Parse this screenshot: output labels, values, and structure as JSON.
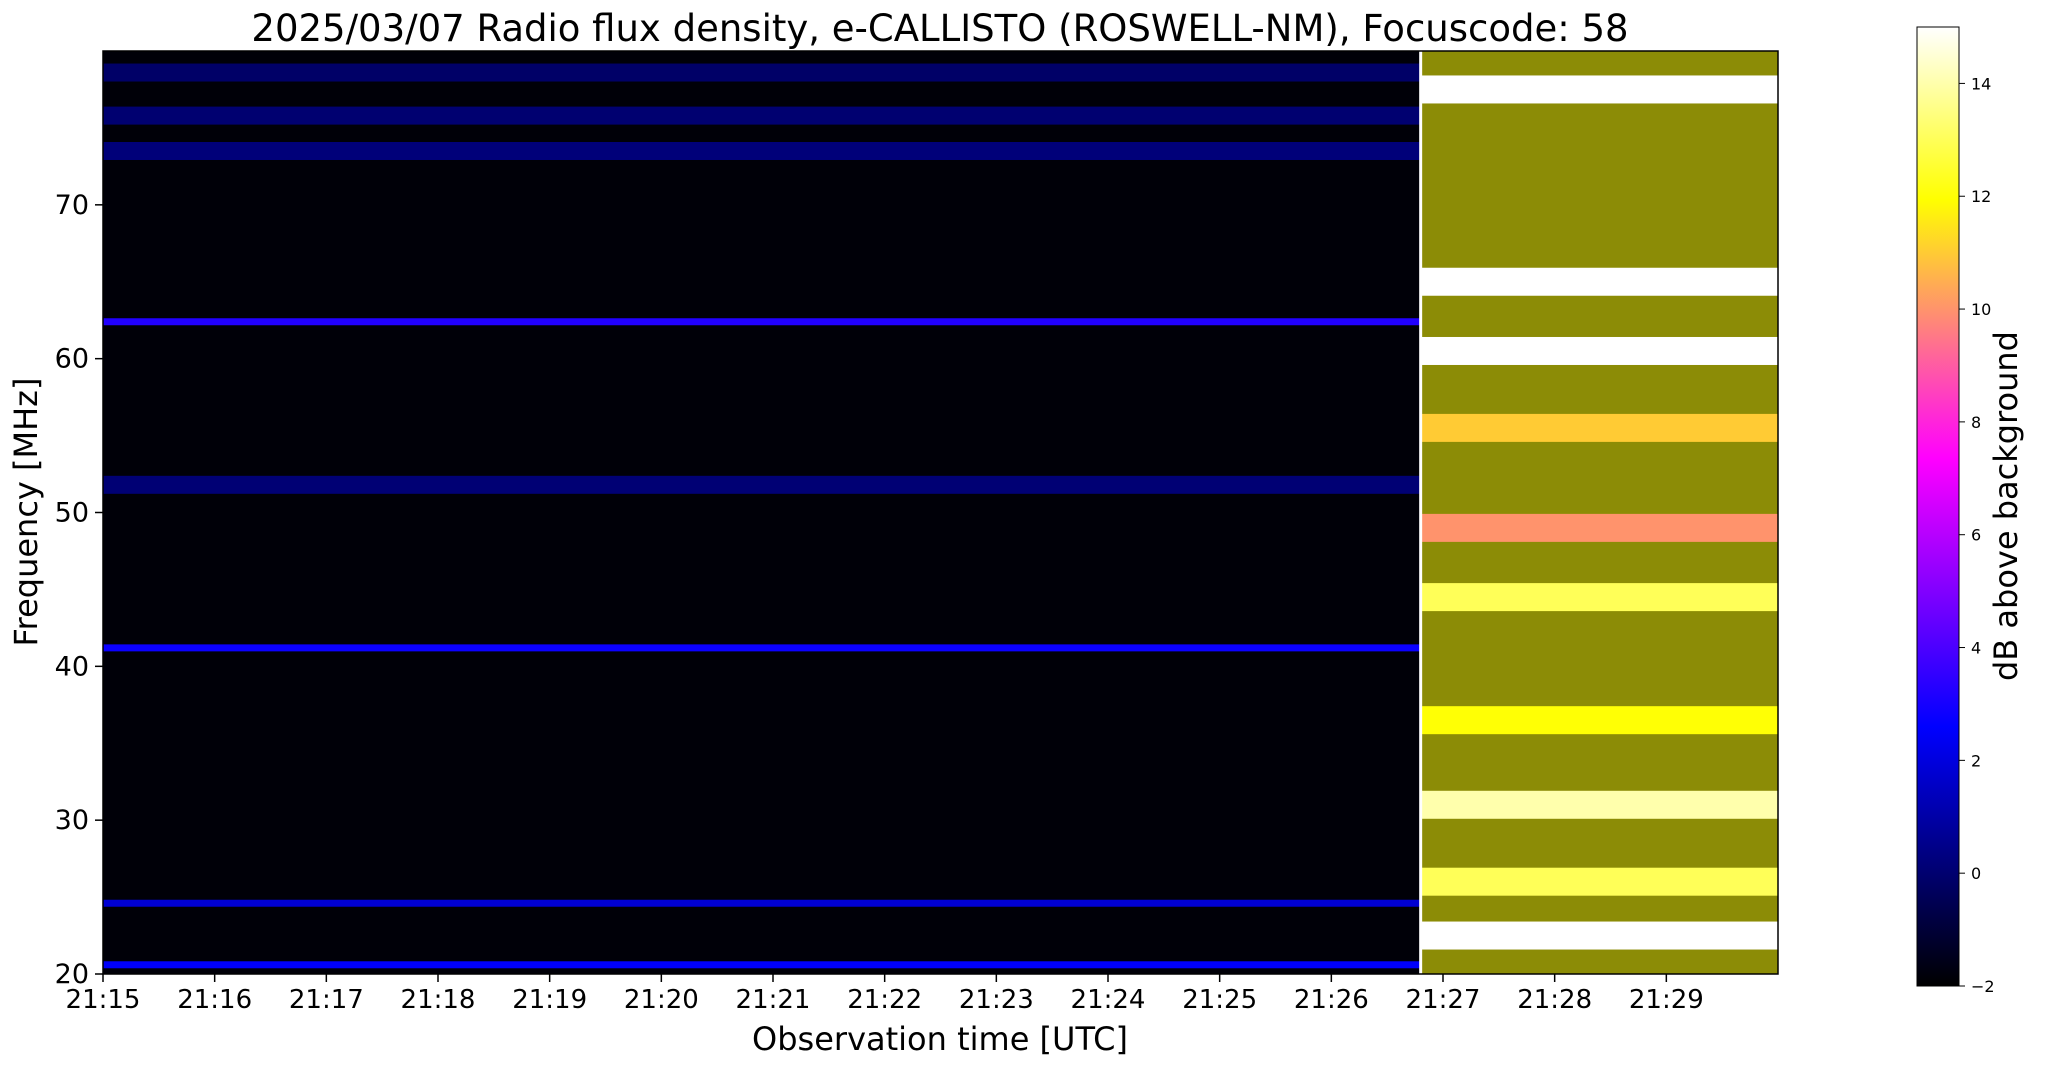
{
  "chart_data": {
    "type": "heatmap",
    "title": "2025/03/07  Radio flux density, e-CALLISTO (ROSWELL-NM), Focuscode: 58",
    "xlabel": "Observation time [UTC]",
    "ylabel": "Frequency [MHz]",
    "x_ticks": [
      "21:15",
      "21:16",
      "21:17",
      "21:18",
      "21:19",
      "21:20",
      "21:21",
      "21:22",
      "21:23",
      "21:24",
      "21:25",
      "21:26",
      "21:27",
      "21:28",
      "21:29"
    ],
    "xlim": [
      "21:15:00",
      "21:30:00"
    ],
    "y_ticks": [
      20,
      30,
      40,
      50,
      60,
      70
    ],
    "ylim": [
      20,
      80
    ],
    "colorbar": {
      "label": "dB above background",
      "ticks": [
        -2,
        0,
        2,
        4,
        6,
        8,
        10,
        12,
        14
      ],
      "range": [
        -2,
        15
      ],
      "colors": [
        "#000000",
        "#0000ff",
        "#ff00ff",
        "#ffff00",
        "#ffffff"
      ]
    },
    "event": {
      "start": "21:26:48",
      "description_level_db": 12
    },
    "quiet_bands_mhz": [
      {
        "freq": 20.6,
        "db": 2.5
      },
      {
        "freq": 24.6,
        "db": 1.8
      },
      {
        "freq": 41.2,
        "db": 2.8
      },
      {
        "freq": 62.4,
        "db": 3.2
      },
      {
        "freq": 51.8,
        "db": 0.6
      },
      {
        "freq": 73.5,
        "db": 0.7
      },
      {
        "freq": 75.8,
        "db": 0.5
      },
      {
        "freq": 78.6,
        "db": 0.3
      }
    ],
    "burst_bands_mhz": [
      {
        "freq": 22.5,
        "db": 15
      },
      {
        "freq": 26.0,
        "db": 13
      },
      {
        "freq": 31.0,
        "db": 14
      },
      {
        "freq": 36.5,
        "db": 12
      },
      {
        "freq": 44.5,
        "db": 13
      },
      {
        "freq": 49.0,
        "db": 10
      },
      {
        "freq": 55.5,
        "db": 11
      },
      {
        "freq": 60.5,
        "db": 15
      },
      {
        "freq": 65.0,
        "db": 15
      },
      {
        "freq": 77.5,
        "db": 15
      }
    ]
  }
}
